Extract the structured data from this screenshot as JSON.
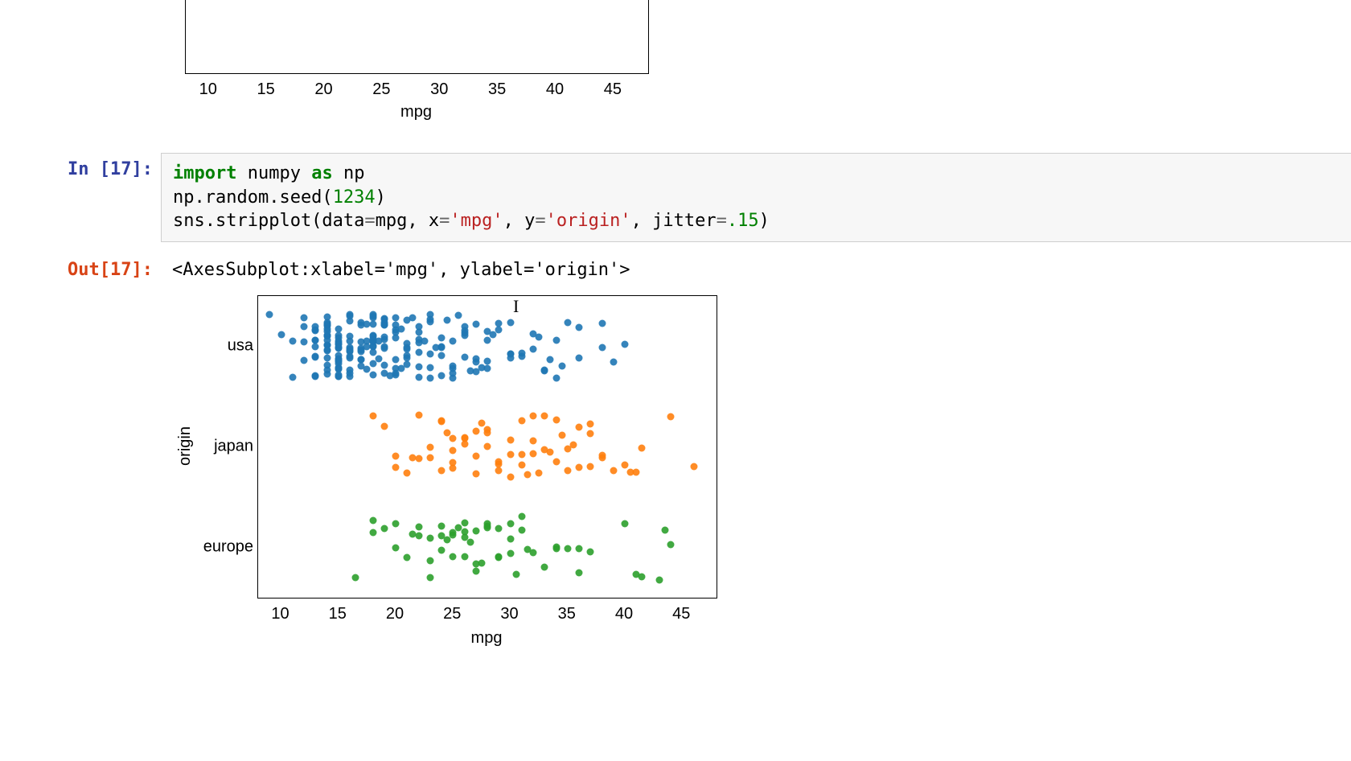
{
  "prev_output": {
    "xlabel": "mpg",
    "xticks": [
      10,
      15,
      20,
      25,
      30,
      35,
      40,
      45
    ]
  },
  "cell": {
    "exec_count": 17,
    "in_label": "In [17]:",
    "out_label": "Out[17]:",
    "code_tokens": [
      {
        "t": "import",
        "c": "kw"
      },
      {
        "t": " ",
        "c": "nm"
      },
      {
        "t": "numpy",
        "c": "nm"
      },
      {
        "t": " ",
        "c": "nm"
      },
      {
        "t": "as",
        "c": "kw"
      },
      {
        "t": " ",
        "c": "nm"
      },
      {
        "t": "np",
        "c": "nm"
      },
      {
        "t": "\n",
        "c": "nm"
      },
      {
        "t": "np.random.seed(",
        "c": "nm"
      },
      {
        "t": "1234",
        "c": "num"
      },
      {
        "t": ")",
        "c": "nm"
      },
      {
        "t": "\n",
        "c": "nm"
      },
      {
        "t": "sns.stripplot(data",
        "c": "nm"
      },
      {
        "t": "=",
        "c": "op"
      },
      {
        "t": "mpg, x",
        "c": "nm"
      },
      {
        "t": "=",
        "c": "op"
      },
      {
        "t": "'mpg'",
        "c": "str"
      },
      {
        "t": ", y",
        "c": "nm"
      },
      {
        "t": "=",
        "c": "op"
      },
      {
        "t": "'origin'",
        "c": "str"
      },
      {
        "t": ", jitter",
        "c": "nm"
      },
      {
        "t": "=",
        "c": "op"
      },
      {
        "t": ".15",
        "c": "num"
      },
      {
        "t": ")",
        "c": "nm"
      }
    ],
    "output_repr": "<AxesSubplot:xlabel='mpg', ylabel='origin'>"
  },
  "chart_data": {
    "type": "scatter",
    "title": "",
    "xlabel": "mpg",
    "ylabel": "origin",
    "xlim": [
      8,
      48
    ],
    "xticks": [
      10,
      15,
      20,
      25,
      30,
      35,
      40,
      45
    ],
    "y_categories": [
      "usa",
      "japan",
      "europe"
    ],
    "jitter": 0.15,
    "colors": {
      "usa": "#1f77b4",
      "japan": "#ff7f0e",
      "europe": "#2ca02c"
    },
    "series": [
      {
        "name": "usa",
        "x": [
          9,
          10,
          11,
          11,
          12,
          12,
          12,
          12,
          13,
          13,
          13,
          13,
          13,
          13,
          13,
          13,
          13,
          13,
          14,
          14,
          14,
          14,
          14,
          14,
          14,
          14,
          14,
          14,
          14,
          14,
          14,
          14,
          14,
          14,
          14,
          14,
          14,
          14,
          15,
          15,
          15,
          15,
          15,
          15,
          15,
          15,
          15,
          15,
          15,
          15,
          15,
          15,
          15,
          15,
          15,
          15,
          15,
          15,
          15,
          15,
          16,
          16,
          16,
          16,
          16,
          16,
          16,
          16,
          16,
          16,
          16,
          16,
          16,
          16,
          17,
          17,
          17,
          17,
          17,
          17,
          17,
          17,
          17,
          17,
          17.5,
          17.5,
          17.5,
          17.5,
          18,
          18,
          18,
          18,
          18,
          18,
          18,
          18,
          18,
          18,
          18,
          18,
          18,
          18,
          18,
          18,
          18.5,
          18.5,
          19,
          19,
          19,
          19,
          19,
          19,
          19,
          19,
          19,
          19,
          19,
          19,
          19.5,
          20,
          20,
          20,
          20,
          20,
          20,
          20,
          20,
          20,
          20.5,
          20.5,
          21,
          21,
          21,
          21,
          21,
          21,
          21,
          21.5,
          22,
          22,
          22,
          22,
          22,
          22,
          22,
          22.5,
          23,
          23,
          23,
          23,
          23,
          23,
          23.5,
          24,
          24,
          24,
          24,
          24,
          24.5,
          25,
          25,
          25,
          25,
          25,
          25.5,
          26,
          26,
          26,
          26,
          26,
          26.5,
          27,
          27,
          27,
          27,
          27.5,
          28,
          28,
          28,
          28,
          28.5,
          29,
          29,
          30,
          30,
          30,
          30,
          31,
          31,
          32,
          32,
          32.5,
          33,
          33,
          33.5,
          34,
          34,
          34.5,
          35,
          36,
          36,
          38,
          38,
          39,
          40
        ]
      },
      {
        "name": "japan",
        "x": [
          18,
          19,
          20,
          20,
          21,
          21.5,
          22,
          22,
          23,
          23,
          24,
          24,
          24,
          24.5,
          25,
          25,
          25,
          25,
          26,
          26,
          26,
          27,
          27,
          27,
          27.5,
          28,
          28,
          28,
          29,
          29,
          29,
          30,
          30,
          30,
          31,
          31,
          31,
          31.5,
          32,
          32,
          32,
          32.5,
          33,
          33,
          33.5,
          34,
          34,
          34.5,
          35,
          35,
          35.5,
          36,
          36,
          37,
          37,
          37,
          38,
          38,
          39,
          40,
          40.5,
          41,
          41.5,
          44,
          46
        ]
      },
      {
        "name": "europe",
        "x": [
          16.5,
          18,
          18,
          19,
          20,
          20,
          21,
          21.5,
          22,
          22,
          23,
          23,
          23,
          24,
          24,
          24,
          24.5,
          25,
          25,
          25,
          25.5,
          26,
          26,
          26,
          26,
          26.5,
          27,
          27,
          27,
          27.5,
          28,
          28,
          28,
          29,
          29,
          29,
          30,
          30,
          30,
          30.5,
          31,
          31,
          31.5,
          32,
          33,
          34,
          34,
          35,
          36,
          36,
          37,
          40,
          41,
          41.5,
          43,
          43.5,
          44
        ]
      }
    ]
  },
  "cursor": {
    "glyph": "I"
  }
}
